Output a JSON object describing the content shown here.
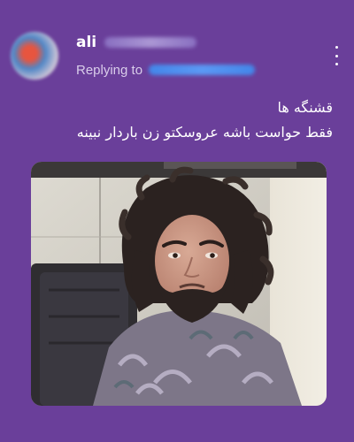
{
  "tweet": {
    "author_name": "ali",
    "replying_label": "Replying to",
    "text_lines": [
      "قشنگه ها",
      "فقط حواست باشه عروسکتو زن باردار نبینه"
    ],
    "menu_icon": "more-vertical-icon",
    "media_description": "photo"
  }
}
